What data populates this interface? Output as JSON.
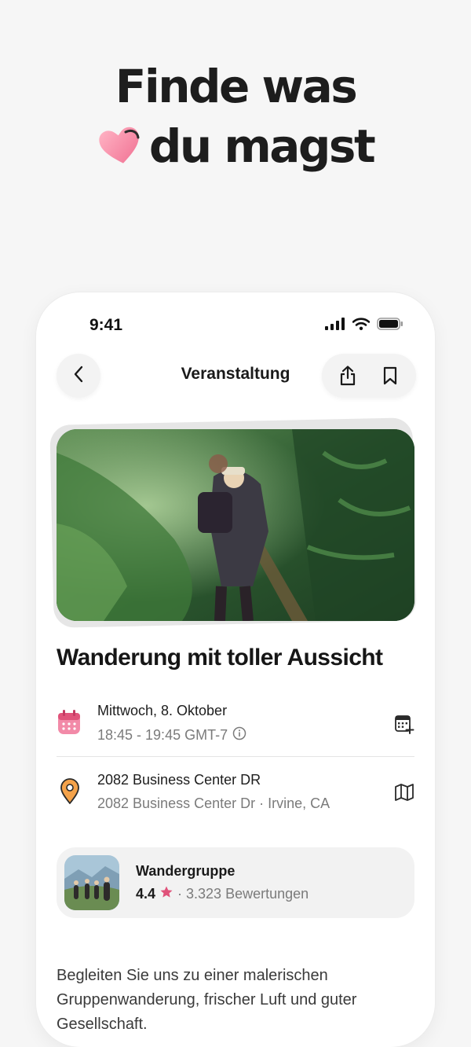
{
  "headline": {
    "line1": "Finde was",
    "line2": "du magst"
  },
  "status_bar": {
    "time": "9:41"
  },
  "nav": {
    "title": "Veranstaltung"
  },
  "event": {
    "title": "Wanderung mit toller Aussicht",
    "date": "Mittwoch, 8. Oktober",
    "time": "18:45 - 19:45 GMT-7",
    "address": "2082 Business Center DR",
    "address_detail": "2082 Business Center Dr · Irvine, CA"
  },
  "group": {
    "name": "Wandergruppe",
    "rating": "4.4",
    "reviews": "· 3.323 Bewertungen"
  },
  "description": "Begleiten Sie uns zu einer malerischen Gruppenwanderung, frischer Luft und guter Gesellschaft.",
  "colors": {
    "accent_pink": "#e0527a",
    "accent_orange": "#f4a24a",
    "background": "#f6f6f6"
  }
}
